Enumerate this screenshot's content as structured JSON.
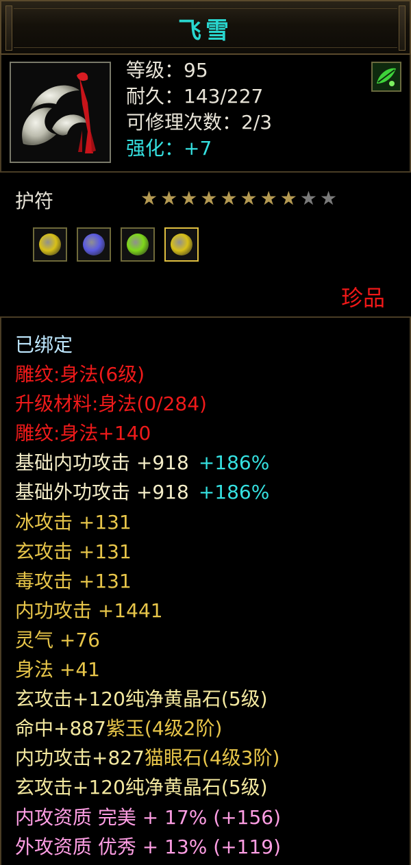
{
  "title": "飞雪",
  "info": {
    "level": "等级：95",
    "durability": "耐久：143/227",
    "repairs": "可修理次数：2/3",
    "enhance": "强化：+7"
  },
  "type_label": "护符",
  "stars": {
    "filled": 8,
    "total": 10
  },
  "gems": [
    {
      "name": "gem-slot-1",
      "color": "#d8c018"
    },
    {
      "name": "gem-slot-2",
      "color": "#5a5ae0"
    },
    {
      "name": "gem-slot-3",
      "color": "#7ed81a"
    },
    {
      "name": "gem-slot-4",
      "color": "#d8c018"
    }
  ],
  "rarity": "珍品",
  "attributes": [
    {
      "text": "已绑定",
      "color": "c-bound"
    },
    {
      "text": "雕纹:身法(6级)",
      "color": "c-red"
    },
    {
      "text": "升级材料:身法(0/284)",
      "color": "c-red"
    },
    {
      "text": "雕纹:身法+140",
      "color": "c-red"
    },
    {
      "text": "基础内功攻击  +918",
      "suffix": "+186%",
      "color": "c-cream"
    },
    {
      "text": "基础外功攻击  +918",
      "suffix": "+186%",
      "color": "c-cream"
    },
    {
      "text": "冰攻击  +131",
      "color": "c-gold"
    },
    {
      "text": "玄攻击  +131",
      "color": "c-gold"
    },
    {
      "text": "毒攻击  +131",
      "color": "c-gold"
    },
    {
      "text": "内功攻击  +1441",
      "color": "c-gold"
    },
    {
      "text": "灵气  +76",
      "color": "c-gold"
    },
    {
      "text": "身法  +41",
      "color": "c-gold"
    },
    {
      "text": "玄攻击+120纯净黄晶石(5级)",
      "color": "c-yellow"
    },
    {
      "text": "命中+887",
      "gem": "紫玉(4级2阶)",
      "color": "c-yellow"
    },
    {
      "text": "内功攻击+827",
      "gem": "猫眼石(4级3阶)",
      "color": "c-yellow"
    },
    {
      "text": "玄攻击+120纯净黄晶石(5级)",
      "color": "c-yellow"
    },
    {
      "text": "内攻资质  完美  +  17%  (+156)",
      "color": "c-pink"
    },
    {
      "text": "外攻资质  优秀  +  13%  (+119)",
      "color": "c-pink"
    }
  ]
}
